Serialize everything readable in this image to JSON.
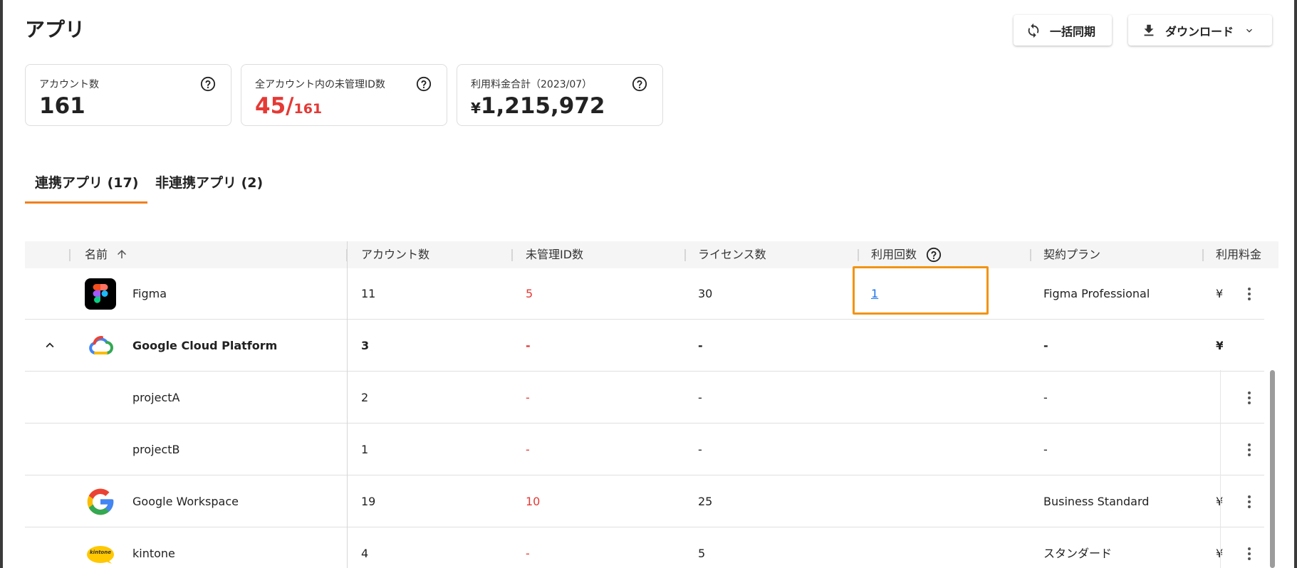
{
  "header": {
    "title": "アプリ",
    "sync_label": "一括同期",
    "download_label": "ダウンロード"
  },
  "summary": [
    {
      "label": "アカウント数",
      "value": "161"
    },
    {
      "label": "全アカウント内の未管理ID数",
      "value": "45/",
      "total": "161"
    },
    {
      "label": "利用料金合計（2023/07）",
      "currency": "¥",
      "value": "1,215,972"
    }
  ],
  "tabs": [
    {
      "label": "連携アプリ (17)",
      "active": true
    },
    {
      "label": "非連携アプリ (2)",
      "active": false
    }
  ],
  "table": {
    "columns": [
      "名前",
      "アカウント数",
      "未管理ID数",
      "ライセンス数",
      "利用回数",
      "契約プラン",
      "利用料金"
    ],
    "rows": [
      {
        "name": "Figma",
        "icon": "figma-logo",
        "accounts": "11",
        "unmanaged": "5",
        "licenses": "30",
        "usage": "1",
        "plan": "Figma Professional",
        "fee": "¥"
      },
      {
        "name": "Google Cloud Platform",
        "icon": "google-cloud-logo",
        "accounts": "3",
        "unmanaged": "-",
        "licenses": "-",
        "usage": "",
        "plan": "-",
        "fee": "¥",
        "expanded": true
      },
      {
        "name": "projectA",
        "accounts": "2",
        "unmanaged": "-",
        "licenses": "-",
        "usage": "",
        "plan": "-",
        "fee": ""
      },
      {
        "name": "projectB",
        "accounts": "1",
        "unmanaged": "-",
        "licenses": "-",
        "usage": "",
        "plan": "-",
        "fee": ""
      },
      {
        "name": "Google Workspace",
        "icon": "google-logo",
        "accounts": "19",
        "unmanaged": "10",
        "licenses": "25",
        "usage": "",
        "plan": "Business Standard",
        "fee": "¥"
      },
      {
        "name": "kintone",
        "icon": "kintone-logo",
        "logo_text": "kintone",
        "accounts": "4",
        "unmanaged": "-",
        "licenses": "5",
        "usage": "",
        "plan": "スタンダード",
        "fee": "¥"
      }
    ]
  },
  "colors": {
    "accent": "#f0801e",
    "alert": "#e53935",
    "link": "#1a73e8",
    "highlight": "#f29413"
  }
}
